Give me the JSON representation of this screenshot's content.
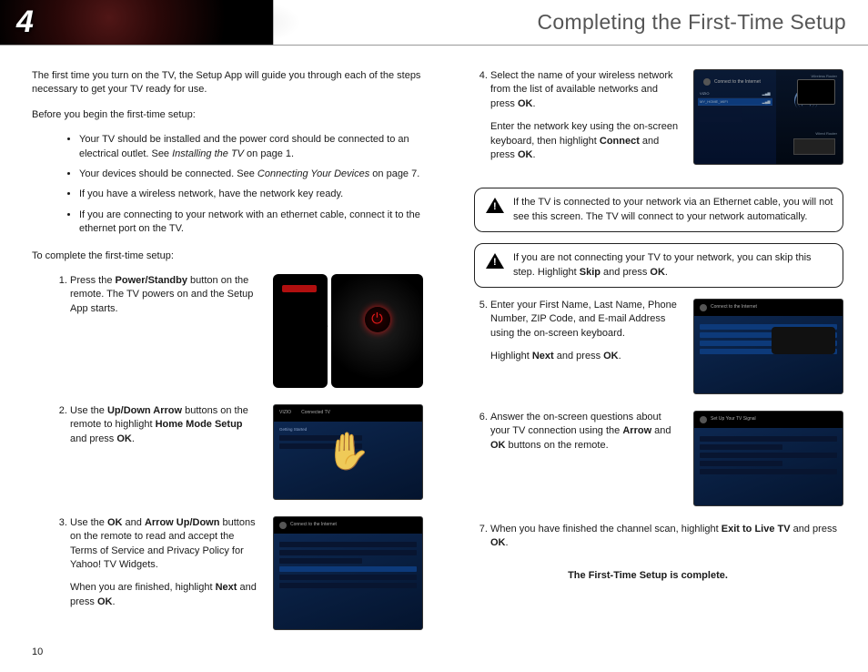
{
  "chapter_number": "4",
  "chapter_title": "Completing the First-Time Setup",
  "page_number": "10",
  "intro": "The first time you turn on the TV, the Setup App will guide you through each of the steps necessary to get your TV ready for use.",
  "before_intro": "Before you begin the first-time setup:",
  "bullets": {
    "b1a": "Your TV should be installed and the power cord should be connected to an electrical outlet. See ",
    "b1i": "Installing the TV",
    "b1b": " on page 1.",
    "b2a": "Your devices should be connected. See ",
    "b2i": "Connecting Your Devices",
    "b2b": " on page 7.",
    "b3": "If you have a wireless network, have the network key ready.",
    "b4": "If you are connecting to your network with an ethernet cable, connect it to the ethernet port on the TV."
  },
  "to_complete": "To complete the first-time setup:",
  "steps": {
    "s1a": "Press the ",
    "s1b": "Power/Standby",
    "s1c": " button on the remote. The TV powers on and the Setup App starts.",
    "s2a": "Use the ",
    "s2b": "Up/Down Arrow",
    "s2c": " buttons on the remote to highlight ",
    "s2d": "Home Mode Setup",
    "s2e": " and press ",
    "s2f": "OK",
    "s2g": ".",
    "s3a": "Use the ",
    "s3b": "OK",
    "s3c": " and ",
    "s3d": "Arrow Up/Down",
    "s3e": " buttons on the remote to read and accept the Terms of Service and Privacy Policy for Yahoo! TV Widgets.",
    "s3f": "When you are finished, highlight ",
    "s3g": "Next",
    "s3h": " and press ",
    "s3i": "OK",
    "s3j": ".",
    "s4a": "Select the name of your wireless network from the list of available networks and press ",
    "s4b": "OK",
    "s4c": ".",
    "s4d": "Enter the network key using the on-screen keyboard, then highlight ",
    "s4e": "Connect",
    "s4f": " and press ",
    "s4g": "OK",
    "s4h": ".",
    "s5a": "Enter your First Name, Last Name, Phone Number, ZIP Code, and E-mail Address using the on-screen keyboard.",
    "s5b": "Highlight ",
    "s5c": "Next",
    "s5d": " and press ",
    "s5e": "OK",
    "s5f": ".",
    "s6a": "Answer the on-screen questions about your TV connection using the ",
    "s6b": "Arrow",
    "s6c": " and ",
    "s6d": "OK",
    "s6e": " buttons on the remote.",
    "s7a": "When you have finished the channel scan, highlight ",
    "s7b": "Exit to Live TV",
    "s7c": " and press ",
    "s7d": "OK",
    "s7e": "."
  },
  "warn1": "If the TV is connected to your network via an Ethernet cable, you will not see this screen. The TV will connect to your network automatically.",
  "warn2a": "If you are not connecting your TV to your network, you can skip this step. Highlight ",
  "warn2b": "Skip",
  "warn2c": " and press ",
  "warn2d": "OK",
  "warn2e": ".",
  "complete": "The First-Time Setup is complete.",
  "screens": {
    "getting_started_title": "Getting Started",
    "vizio": "VIZIO",
    "connected_tv": "Connected TV",
    "connect_net_title": "Connect to the Internet",
    "setup_signal_title": "Set Up Your TV Signal",
    "wireless_router": "Wireless Router",
    "wired_router": "Wired Router",
    "net_vizio": "VIZIO",
    "net_wap": "MY_HOME_WIFI"
  }
}
